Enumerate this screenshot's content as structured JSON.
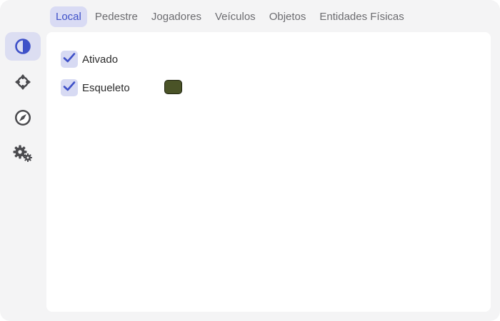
{
  "sidebar": {
    "items": [
      {
        "icon": "contrast-icon",
        "active": true
      },
      {
        "icon": "crosshair-icon",
        "active": false
      },
      {
        "icon": "compass-icon",
        "active": false
      },
      {
        "icon": "gears-icon",
        "active": false
      }
    ]
  },
  "tabs": [
    {
      "label": "Local",
      "active": true
    },
    {
      "label": "Pedestre",
      "active": false
    },
    {
      "label": "Jogadores",
      "active": false
    },
    {
      "label": "Veículos",
      "active": false
    },
    {
      "label": "Objetos",
      "active": false
    },
    {
      "label": "Entidades Físicas",
      "active": false
    }
  ],
  "options": {
    "enabled": {
      "label": "Ativado",
      "checked": true
    },
    "skeleton": {
      "label": "Esqueleto",
      "checked": true,
      "color": "#4a5327"
    }
  },
  "colors": {
    "accent": "#3f51c8",
    "active_bg": "#d9dbf4",
    "window_bg": "#f4f4f5",
    "panel_bg": "#ffffff"
  }
}
